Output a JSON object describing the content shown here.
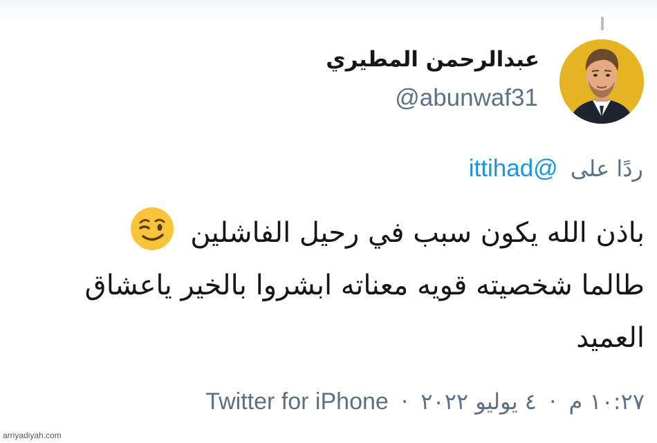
{
  "author": {
    "display_name": "عبدالرحمن المطيري",
    "handle": "@abunwaf31",
    "avatar_icon": "user-photo-avatar",
    "avatar_bg": "#e6b422"
  },
  "reply": {
    "label": "ردًا على",
    "target": "@ittihad",
    "target_color": "#1b95e0"
  },
  "tweet": {
    "lines": [
      "باذن الله يكون سبب في رحيل الفاشلين",
      "طالما شخصيته قويه معناته ابشروا بالخير ياعشاق",
      "العميد"
    ],
    "emoji": "winking-face-emoji"
  },
  "meta": {
    "time": "١٠:٢٧ م",
    "separator": "·",
    "date": "٤ يوليو ٢٠٢٢",
    "source": "Twitter for iPhone"
  },
  "watermark": "arriyadiyah.com",
  "colors": {
    "text": "#14171a",
    "secondary": "#5b7083",
    "link": "#1b95e0"
  }
}
